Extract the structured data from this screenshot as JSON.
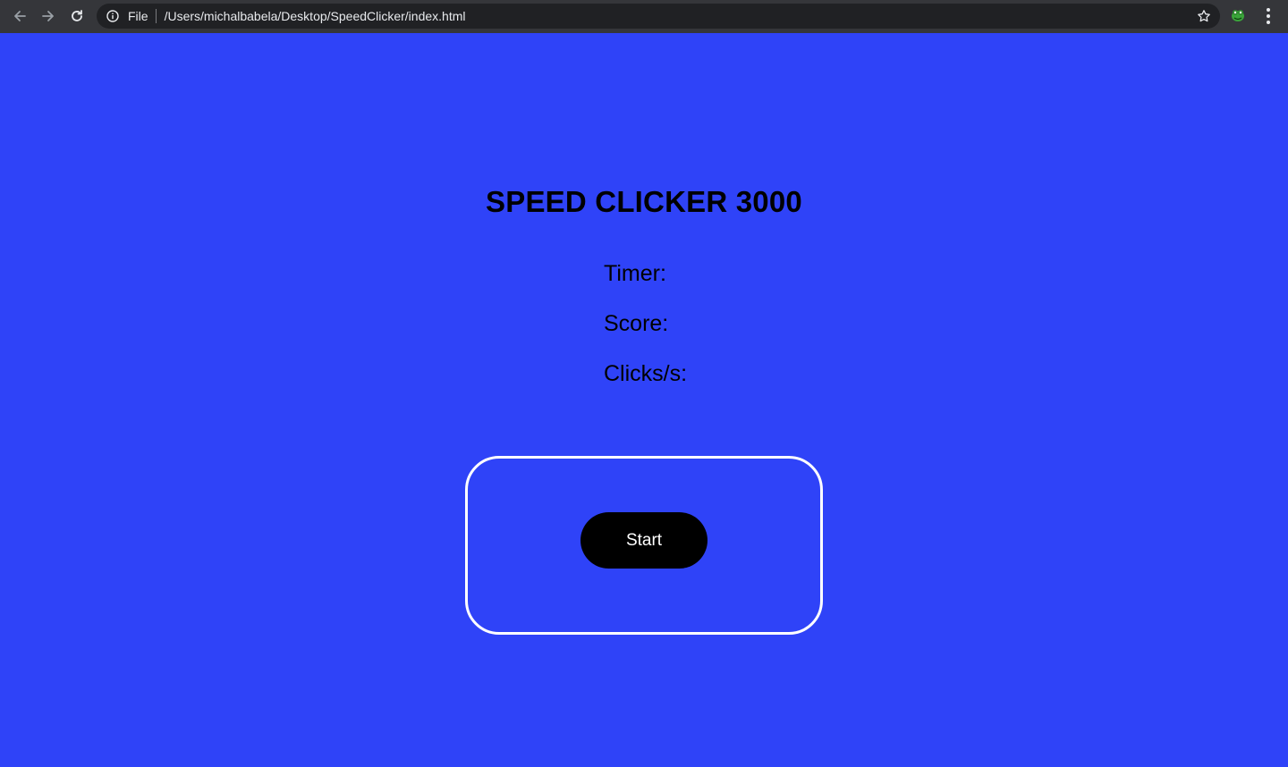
{
  "browser": {
    "scheme_label": "File",
    "url": "/Users/michalbabela/Desktop/SpeedClicker/index.html",
    "icons": {
      "back": "arrow-left-icon",
      "forward": "arrow-right-icon",
      "reload": "reload-icon",
      "info": "info-icon",
      "bookmark": "star-icon",
      "extension": "extension-icon",
      "menu": "kebab-menu-icon"
    }
  },
  "page": {
    "background_color": "#2f43f8",
    "title": "SPEED CLICKER 3000",
    "stats": {
      "timer_label": "Timer:",
      "score_label": "Score:",
      "cps_label": "Clicks/s:"
    },
    "click_area": {
      "border_color": "#ffffff",
      "start_label": "Start"
    }
  }
}
